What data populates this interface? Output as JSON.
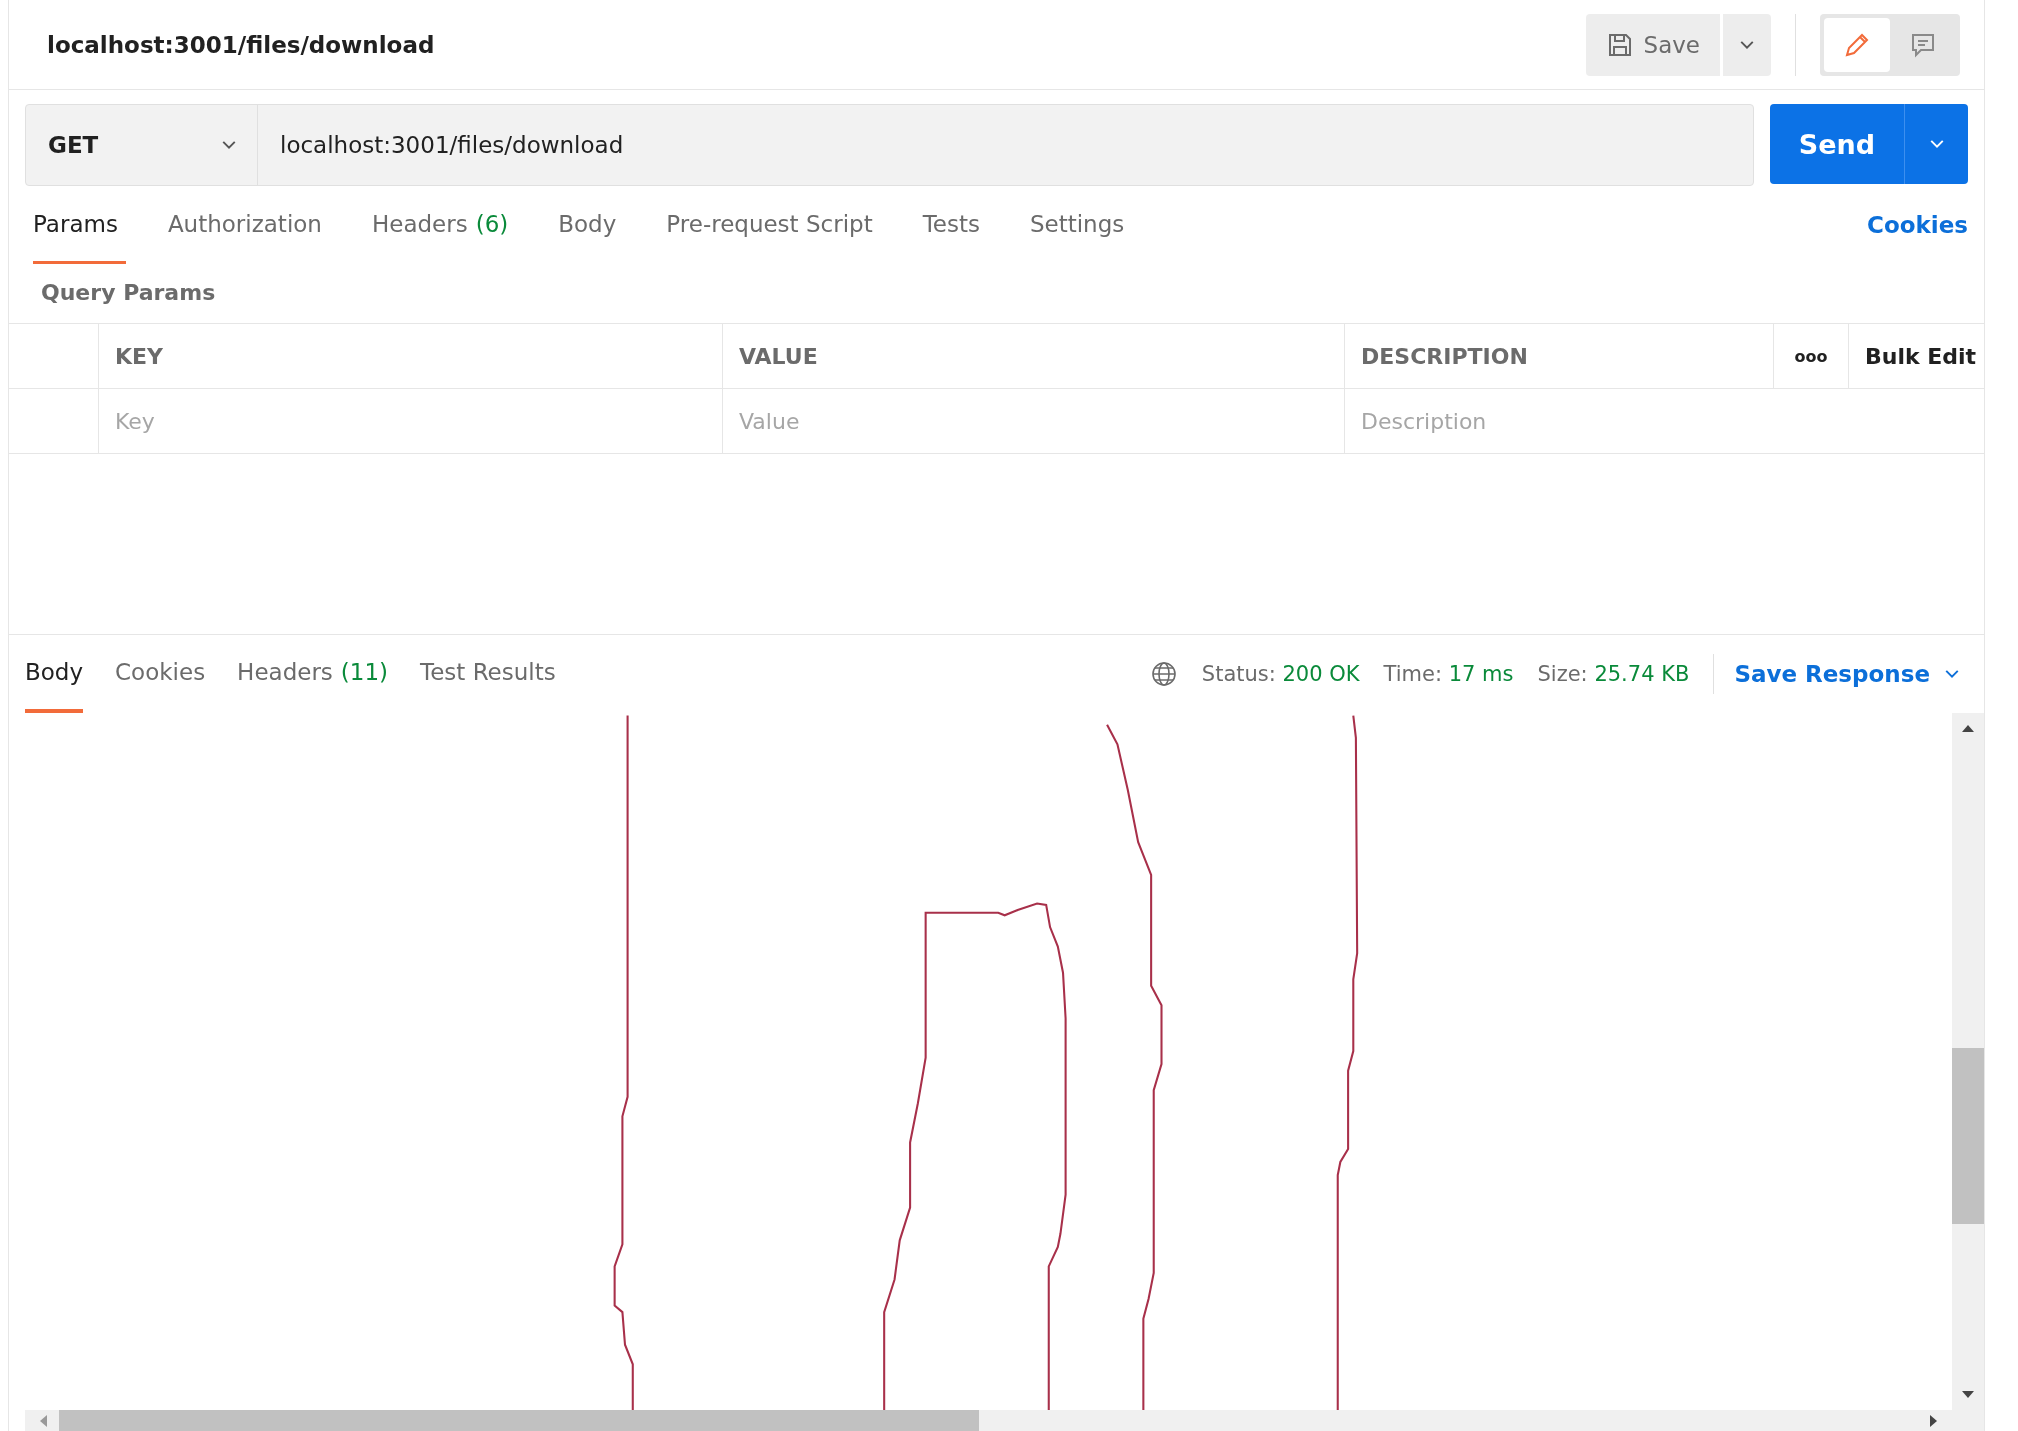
{
  "header": {
    "title": "localhost:3001/files/download",
    "save_label": "Save",
    "mode_buttons": [
      {
        "kind": "edit",
        "selected": true
      },
      {
        "kind": "comments",
        "selected": false
      }
    ]
  },
  "request": {
    "method": "GET",
    "url": "localhost:3001/files/download",
    "send_label": "Send"
  },
  "request_tabs": [
    {
      "label": "Params",
      "selected": true
    },
    {
      "label": "Authorization",
      "selected": false
    },
    {
      "label": "Headers",
      "count": "(6)",
      "selected": false
    },
    {
      "label": "Body",
      "selected": false
    },
    {
      "label": "Pre-request Script",
      "selected": false
    },
    {
      "label": "Tests",
      "selected": false
    },
    {
      "label": "Settings",
      "selected": false
    }
  ],
  "cookies_link": "Cookies",
  "query_params": {
    "title": "Query Params",
    "columns": [
      "KEY",
      "VALUE",
      "DESCRIPTION"
    ],
    "more": "ooo",
    "bulk_edit": "Bulk Edit",
    "placeholders": [
      "Key",
      "Value",
      "Description"
    ]
  },
  "response_tabs": [
    {
      "label": "Body",
      "selected": true
    },
    {
      "label": "Cookies",
      "selected": false
    },
    {
      "label": "Headers",
      "count": "(11)",
      "selected": false
    },
    {
      "label": "Test Results",
      "selected": false
    }
  ],
  "response_status": [
    {
      "label": "Status:",
      "value": "200 OK"
    },
    {
      "label": "Time:",
      "value": "17 ms"
    },
    {
      "label": "Size:",
      "value": "25.74 KB"
    }
  ],
  "save_response": "Save Response"
}
